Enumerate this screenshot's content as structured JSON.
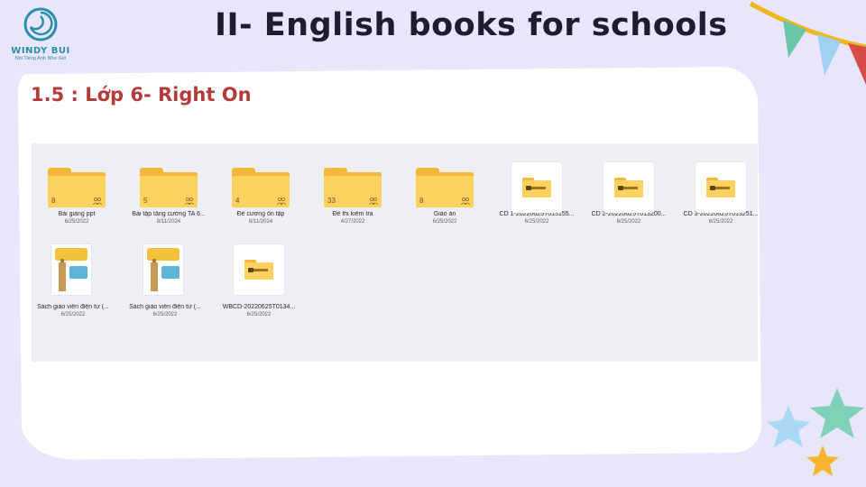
{
  "logo": {
    "name": "WINDY BUI",
    "tagline": "Nói Tiếng Anh Như Gió"
  },
  "title": "II- English books for schools",
  "subtitle": "1.5 : Lớp 6- Right On",
  "files": [
    {
      "kind": "folder",
      "name": "Bài giảng ppt",
      "date": "6/25/2022",
      "count": "8",
      "icon": "folder-icon"
    },
    {
      "kind": "folder",
      "name": "Bài tập tăng cường TA 6...",
      "date": "8/11/2024",
      "count": "5",
      "icon": "folder-icon"
    },
    {
      "kind": "folder",
      "name": "Đề cương ôn tập",
      "date": "8/11/2024",
      "count": "4",
      "icon": "folder-icon"
    },
    {
      "kind": "folder",
      "name": "Đề thi kiểm tra",
      "date": "4/27/2022",
      "count": "33",
      "icon": "folder-icon"
    },
    {
      "kind": "folder",
      "name": "Giáo án",
      "date": "6/25/2022",
      "count": "8",
      "icon": "folder-icon"
    },
    {
      "kind": "zip",
      "name": "CD 1-20220625T013155...",
      "date": "6/25/2022",
      "icon": "zip-folder-icon"
    },
    {
      "kind": "zip",
      "name": "CD 2-20220625T013200...",
      "date": "6/25/2022",
      "icon": "zip-folder-icon"
    },
    {
      "kind": "zip",
      "name": "CD 3-20220625T013251...",
      "date": "6/25/2022",
      "icon": "zip-folder-icon"
    },
    {
      "kind": "book",
      "name": "Sách giáo viên điện tử (...",
      "date": "6/25/2022",
      "icon": "book-cover-thumbnail"
    },
    {
      "kind": "book",
      "name": "Sách giáo viên điện tử (...",
      "date": "6/25/2022",
      "icon": "book-cover-thumbnail"
    },
    {
      "kind": "zip",
      "name": "WBCD-20220625T0134...",
      "date": "6/25/2022",
      "icon": "zip-folder-icon"
    }
  ],
  "colors": {
    "background": "#e7e6fa",
    "title": "#1d1d2e",
    "subtitle": "#b53a3a",
    "folder": "#fdd15f",
    "logo": "#2a8fae"
  }
}
